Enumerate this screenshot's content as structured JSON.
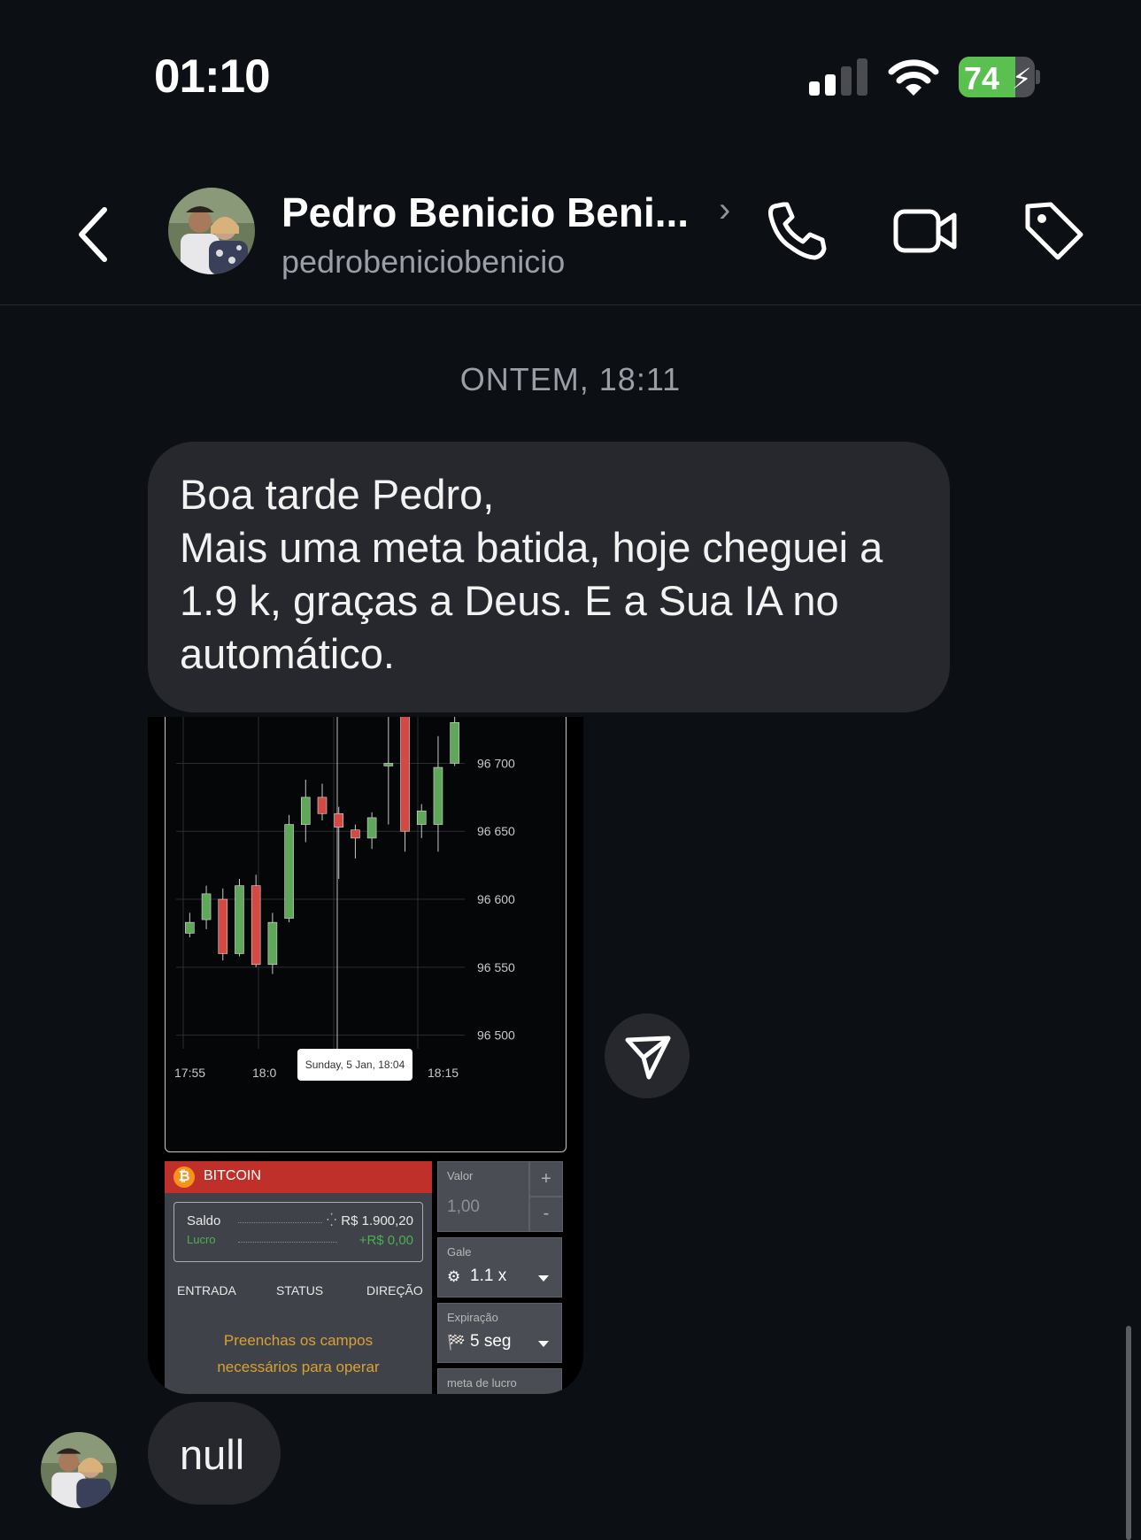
{
  "status_bar": {
    "time": "01:10",
    "battery_level": "74",
    "signal_bars_active": 2,
    "signal_bars_total": 4,
    "icons": [
      "signal-icon",
      "wifi-icon",
      "battery-charging-icon"
    ]
  },
  "header": {
    "contact_name": "Pedro Benicio Beni...",
    "username": "pedrobeniciobenicio",
    "icons": [
      "back-icon",
      "chevron-right-icon",
      "phone-icon",
      "video-icon",
      "tag-icon"
    ]
  },
  "conversation": {
    "timestamp": "ONTEM, 18:11",
    "message_lines": [
      "Boa tarde Pedro,",
      "Mais uma meta batida, hoje cheguei a",
      "1.9 k, graças a Deus. E a Sua IA no",
      "automático."
    ],
    "reply_text": "null"
  },
  "shared_image": {
    "chart_data": {
      "type": "candlestick",
      "y_ticks": [
        "96 700",
        "96 650",
        "96 600",
        "96 550",
        "96 500"
      ],
      "x_ticks": [
        "17:55",
        "18:0",
        "18:15"
      ],
      "ylim": [
        96490,
        96740
      ],
      "tooltip": "Sunday, 5 Jan, 18:04",
      "candles": [
        {
          "o": 96575,
          "c": 96583,
          "h": 96590,
          "l": 96572
        },
        {
          "o": 96585,
          "c": 96604,
          "h": 96610,
          "l": 96578
        },
        {
          "o": 96600,
          "c": 96560,
          "h": 96608,
          "l": 96555
        },
        {
          "o": 96560,
          "c": 96610,
          "h": 96615,
          "l": 96558
        },
        {
          "o": 96610,
          "c": 96552,
          "h": 96618,
          "l": 96550
        },
        {
          "o": 96552,
          "c": 96583,
          "h": 96590,
          "l": 96545
        },
        {
          "o": 96586,
          "c": 96655,
          "h": 96662,
          "l": 96583
        },
        {
          "o": 96655,
          "c": 96675,
          "h": 96688,
          "l": 96642
        },
        {
          "o": 96675,
          "c": 96663,
          "h": 96685,
          "l": 96658
        },
        {
          "o": 96663,
          "c": 96653,
          "h": 96668,
          "l": 96615
        },
        {
          "o": 96651,
          "c": 96645,
          "h": 96655,
          "l": 96630
        },
        {
          "o": 96645,
          "c": 96660,
          "h": 96664,
          "l": 96637
        },
        {
          "o": 96700,
          "c": 96700,
          "h": 96745,
          "l": 96655
        },
        {
          "o": 96745,
          "c": 96650,
          "h": 96745,
          "l": 96635
        },
        {
          "o": 96655,
          "c": 96665,
          "h": 96670,
          "l": 96645
        },
        {
          "o": 96655,
          "c": 96697,
          "h": 96720,
          "l": 96635
        },
        {
          "o": 96700,
          "c": 96730,
          "h": 96745,
          "l": 96698
        }
      ]
    },
    "panel": {
      "asset": "BITCOIN",
      "saldo_label": "Saldo",
      "saldo_value": "R$ 1.900,20",
      "lucro_label": "Lucro",
      "lucro_value": "+R$ 0,00",
      "col_entrada": "ENTRADA",
      "col_status": "STATUS",
      "col_direcao": "DIREÇÃO",
      "notice_line1": "Preenchas os campos",
      "notice_line2": "necessários para operar",
      "valor_label": "Valor",
      "valor_placeholder": "1,00",
      "plus": "+",
      "minus": "-",
      "gale_label": "Gale",
      "gale_value": "1.1 x",
      "expiracao_label": "Expiração",
      "expiracao_value": "5 seg",
      "meta_label": "meta de lucro",
      "colors": {
        "up": "#5fa85a",
        "down": "#d34a45",
        "header": "#c0302b",
        "profit": "#4caf50",
        "notice": "#d9a232"
      }
    }
  }
}
